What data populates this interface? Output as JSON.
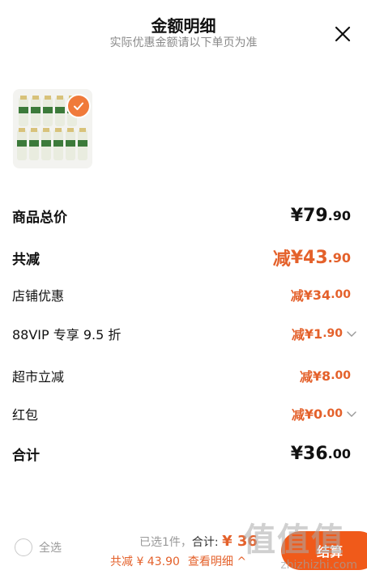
{
  "header": {
    "title": "金额明细",
    "subtitle": "实际优惠金额请以下单页为准",
    "close_icon": "close-icon"
  },
  "product": {
    "selected": true
  },
  "rows": {
    "goods_total": {
      "label": "商品总价",
      "currency": "¥",
      "integer": "79",
      "cents": ".90"
    },
    "total_discount": {
      "label": "共减",
      "prefix": "减",
      "currency": "¥",
      "integer": "43",
      "cents": ".90"
    },
    "shop_coupon": {
      "label": "店铺优惠",
      "prefix": "减",
      "currency": "¥",
      "integer": "34",
      "cents": ".00"
    },
    "vip": {
      "label": "88VIP 专享 9.5 折",
      "prefix": "减",
      "currency": "¥",
      "integer": "1",
      "cents": ".90"
    },
    "supermarket": {
      "label": "超市立减",
      "prefix": "减",
      "currency": "¥",
      "integer": "8",
      "cents": ".00"
    },
    "red_packet": {
      "label": "红包",
      "prefix": "减",
      "currency": "¥",
      "integer": "0",
      "cents": ".00"
    },
    "total": {
      "label": "合计",
      "currency": "¥",
      "integer": "36",
      "cents": ".00"
    }
  },
  "footer": {
    "select_all": "全选",
    "selected_count": "已选1件，",
    "total_label": "合计: ",
    "total_value": "¥ 36",
    "discount_text": "共减 ¥ 43.90",
    "detail_link": "查看明细 ^",
    "checkout_label": "结算"
  },
  "watermark": {
    "text": "值值值",
    "url": "zhizhizhi.com"
  },
  "colors": {
    "accent": "#e4612b",
    "checkout": "#f05a1a"
  }
}
